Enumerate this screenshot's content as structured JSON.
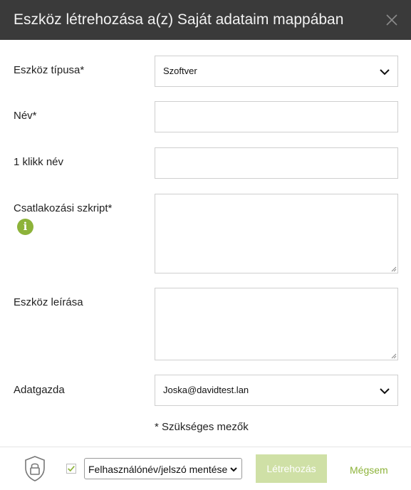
{
  "dialog": {
    "title": "Eszköz létrehozása a(z) Saját adataim mappában"
  },
  "form": {
    "type_label": "Eszköz típusa*",
    "type_value": "Szoftver",
    "name_label": "Név*",
    "name_value": "",
    "oneclick_label": "1 klikk név",
    "oneclick_value": "",
    "script_label": "Csatlakozási szkript*",
    "script_value": "",
    "description_label": "Eszköz leírása",
    "description_value": "",
    "owner_label": "Adatgazda",
    "owner_value": "Joska@davidtest.lan",
    "required_note": "* Szükséges mezők"
  },
  "footer": {
    "save_credentials_checked": true,
    "save_credentials_option": "Felhasználónév/jelszó mentése",
    "create_label": "Létrehozás",
    "cancel_label": "Mégsem"
  },
  "colors": {
    "header_bg": "#3a3a3a",
    "accent": "#8db33a",
    "accent_disabled": "#cfe0a6"
  },
  "icons": {
    "close": "close-icon",
    "chevron": "chevron-down-icon",
    "info": "info-icon",
    "lock": "lock-icon",
    "check": "checkmark-icon"
  }
}
